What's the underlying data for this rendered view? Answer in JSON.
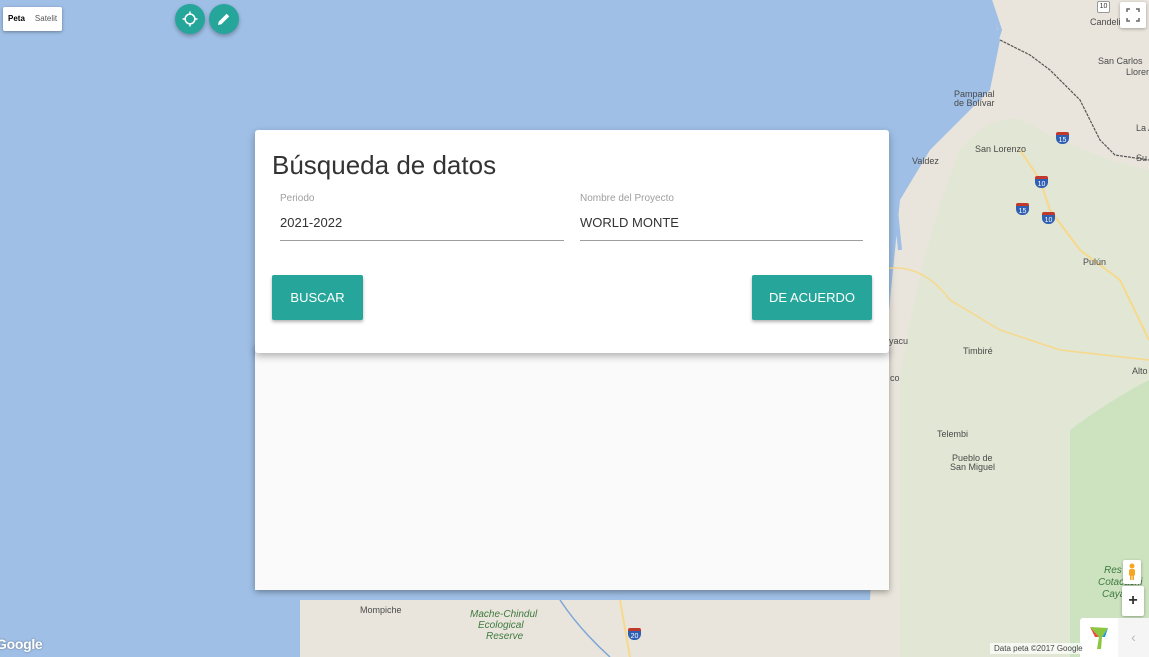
{
  "map": {
    "type_control": {
      "map_label": "Peta",
      "satellite_label": "Satelit"
    },
    "labels": {
      "candelillas": "Candelillas",
      "san_carlos": "San Carlos",
      "lloren": "Lloren",
      "pampanal": "Pampanal",
      "de_bolivar": "de Bolívar",
      "la": "La A",
      "san_lorenzo": "San Lorenzo",
      "valdez": "Valdez",
      "su": "Su",
      "pulun": "Pulún",
      "yacu": "yacu",
      "timbire": "Timbiré",
      "co": "co",
      "alto": "Alto",
      "telembi": "Telembi",
      "pueblo_de": "Pueblo de",
      "san_miguel": "San Miguel",
      "mompiche": "Mompiche",
      "mache_1": "Mache-Chindul",
      "mache_2": "Ecological",
      "mache_3": "Reserve",
      "res_1": "Res",
      "res_2": "Cotacachi",
      "res_3": "Caya"
    },
    "shields": {
      "s10_top": "10",
      "s15": "15",
      "s10_a": "10",
      "s15_b": "15",
      "s10_b": "10",
      "s20": "20"
    },
    "attribution": "Data peta ©2017 Google",
    "google_logo": "Google"
  },
  "controls": {
    "locate_icon": "crosshair-icon",
    "edit_icon": "pencil-icon",
    "fullscreen_icon": "fullscreen-icon",
    "zoom_in": "+",
    "collapse": "‹"
  },
  "dialog": {
    "title": "Búsqueda de datos",
    "periodo": {
      "label": "Periodo",
      "value": "2021-2022"
    },
    "proyecto": {
      "label": "Nombre del Proyecto",
      "value": "WORLD MONTE"
    },
    "buscar_label": "BUSCAR",
    "acuerdo_label": "DE ACUERDO"
  },
  "colors": {
    "accent": "#26a69a",
    "ocean": "#9fbfe6",
    "land": "#e9e5dc",
    "forest": "#cde3c0"
  }
}
